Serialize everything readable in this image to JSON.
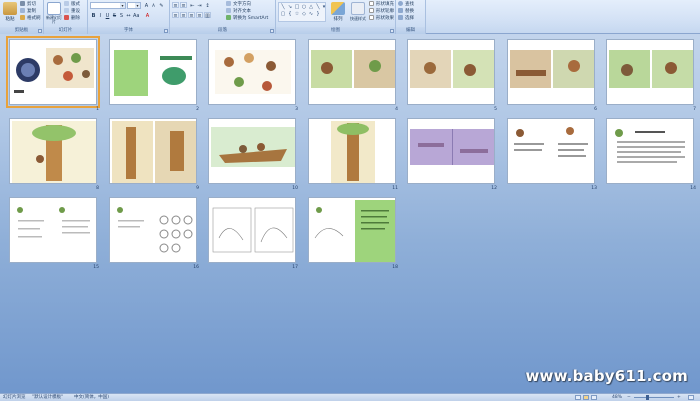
{
  "ribbon": {
    "clipboard": {
      "label": "剪贴板",
      "paste": "粘贴",
      "cut": "剪切",
      "copy": "复制",
      "format_painter": "格式刷"
    },
    "slides": {
      "label": "幻灯片",
      "new_slide": "新建幻灯片",
      "layout": "版式",
      "reset": "重设",
      "delete": "删除"
    },
    "font": {
      "label": "字体",
      "font_name": "",
      "font_size": ""
    },
    "paragraph": {
      "label": "段落",
      "align_text": "对齐文本",
      "convert_smartart": "转换为 SmartArt",
      "text_direction": "文字方向"
    },
    "drawing": {
      "label": "绘图",
      "arrange": "排列",
      "quick_styles": "快速样式",
      "shape_fill": "形状填充",
      "shape_outline": "形状轮廓",
      "shape_effects": "形状效果"
    },
    "editing": {
      "label": "编辑",
      "find": "查找",
      "replace": "替换",
      "select": "选择"
    }
  },
  "slides": [
    {
      "number": "1",
      "selected": true
    },
    {
      "number": "2"
    },
    {
      "number": "3"
    },
    {
      "number": "4"
    },
    {
      "number": "5"
    },
    {
      "number": "6"
    },
    {
      "number": "7"
    },
    {
      "number": "8"
    },
    {
      "number": "9"
    },
    {
      "number": "10"
    },
    {
      "number": "11"
    },
    {
      "number": "12"
    },
    {
      "number": "13"
    },
    {
      "number": "14"
    },
    {
      "number": "15"
    },
    {
      "number": "16"
    },
    {
      "number": "17"
    },
    {
      "number": "18"
    }
  ],
  "status": {
    "view": "幻灯片浏览",
    "theme": "\"默认设计模板\"",
    "language": "中文(简体，中国)",
    "zoom": "48%"
  },
  "watermark": "www.baby611.com",
  "colors": {
    "ribbon_bg": "#d5e3f6",
    "workspace_top": "#c9d9ee",
    "workspace_bottom": "#6f96cc",
    "selection": "#e8a23c",
    "green_slide": "#9ed47c"
  }
}
